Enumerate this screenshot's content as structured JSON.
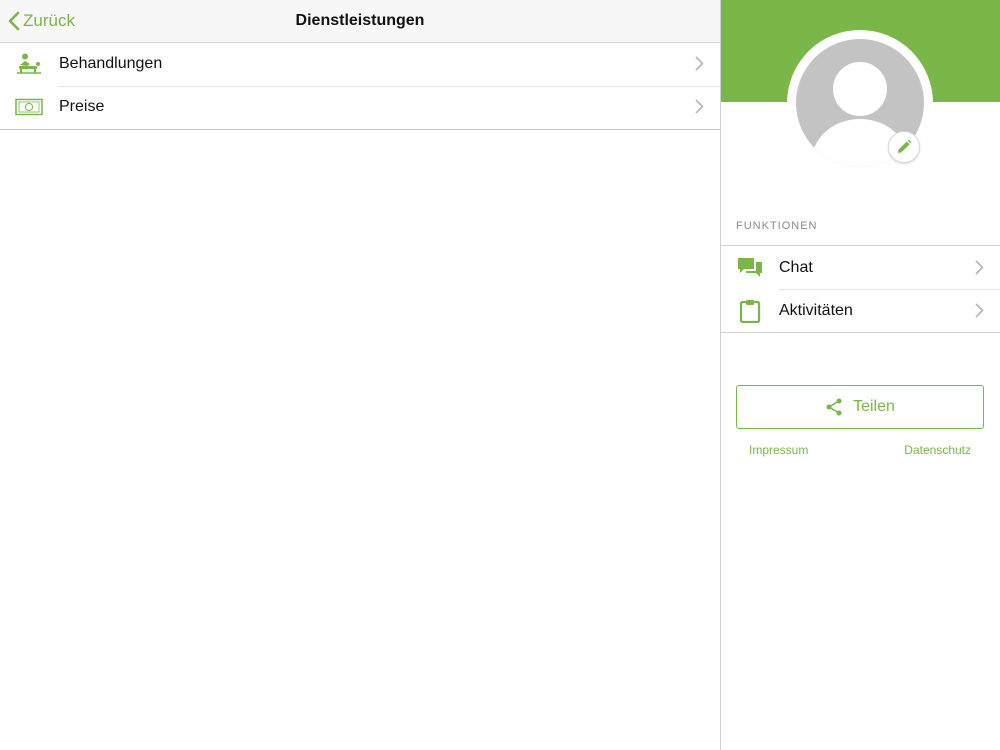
{
  "navbar": {
    "back_label": "Zurück",
    "title": "Dienstleistungen"
  },
  "services": [
    {
      "label": "Behandlungen",
      "icon": "treatment-icon"
    },
    {
      "label": "Preise",
      "icon": "price-tag-icon"
    }
  ],
  "profile": {
    "avatar_icon": "person-placeholder-icon",
    "edit_icon": "pencil-icon"
  },
  "functions": {
    "header": "FUNKTIONEN",
    "items": [
      {
        "label": "Chat",
        "icon": "chat-icon"
      },
      {
        "label": "Aktivitäten",
        "icon": "clipboard-icon"
      }
    ]
  },
  "actions": {
    "share_label": "Teilen",
    "impressum_label": "Impressum",
    "datenschutz_label": "Datenschutz"
  },
  "colors": {
    "accent": "#7ab648",
    "avatar_gray": "#c3c3c3"
  }
}
